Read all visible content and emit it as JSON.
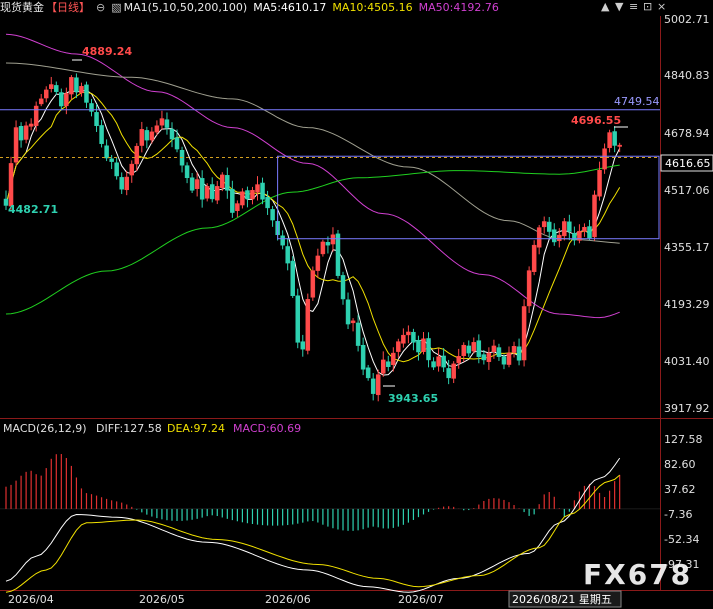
{
  "header": {
    "symbol": "现货黄金",
    "period": "【日线】",
    "ma_label": "MA1(5,10,50,200,100)",
    "ma5": "MA5:4610.17",
    "ma10": "MA10:4505.16",
    "ma50": "MA50:4192.76",
    "controls": [
      "▲",
      "▼",
      "≡",
      "⊡",
      "×"
    ]
  },
  "colors": {
    "up": "#ff4a4a",
    "down": "#2ed1b0",
    "ma5": "#ffffff",
    "ma10": "#f0e000",
    "ma50": "#d040d0",
    "ma100": "#a0a090",
    "ma200": "#20d020",
    "rect": "#7b7bff"
  },
  "price_axis": [
    "5002.71",
    "4840.83",
    "4678.94",
    "4517.06",
    "4355.17",
    "4193.29",
    "4031.40",
    "3917.92"
  ],
  "current_price": "4616.65",
  "annotations": {
    "high": "4889.24",
    "low": "3943.65",
    "start": "4482.71",
    "recent_high": "4696.55",
    "hline": "4749.54"
  },
  "macd_header": {
    "label": "MACD(26,12,9)",
    "diff": "DIFF:127.58",
    "dea": "DEA:97.24",
    "macd": "MACD:60.69"
  },
  "macd_axis": [
    "127.58",
    "82.60",
    "37.62",
    "-7.36",
    "-52.34",
    "-97.31"
  ],
  "x_axis": [
    "2026/04",
    "2026/05",
    "2026/06",
    "2026/07"
  ],
  "cursor_date": "2026/08/21 星期五",
  "watermark": "FX678",
  "chart_data": {
    "type": "candlestick",
    "ylim": [
      3917.92,
      5002.71
    ],
    "hline": 4749.54,
    "current_price": 4616.65,
    "box": {
      "from": 54,
      "to": 110,
      "top": 4620,
      "bottom": 4390
    },
    "closes": [
      4482.71,
      4600,
      4700,
      4665,
      4705,
      4710,
      4760,
      4780,
      4805,
      4820,
      4800,
      4760,
      4795,
      4840,
      4800,
      4815,
      4770,
      4745,
      4705,
      4655,
      4615,
      4605,
      4565,
      4528,
      4562,
      4598,
      4648,
      4695,
      4665,
      4688,
      4705,
      4725,
      4700,
      4668,
      4640,
      4595,
      4560,
      4525,
      4555,
      4500,
      4536,
      4501,
      4536,
      4568,
      4525,
      4463,
      4488,
      4521,
      4501,
      4525,
      4541,
      4500,
      4476,
      4442,
      4401,
      4372,
      4322,
      4231,
      4101,
      4082,
      4221,
      4301,
      4342,
      4381,
      4372,
      4401,
      4287,
      4222,
      4152,
      4161,
      4092,
      4026,
      4002,
      3958,
      4011,
      4052,
      4033,
      4071,
      4103,
      4121,
      4130,
      4101,
      4074,
      4111,
      4052,
      4032,
      4061,
      4032,
      4002,
      4041,
      4062,
      4093,
      4071,
      4101,
      4061,
      4052,
      4071,
      4091,
      4061,
      4040,
      4071,
      4090,
      4051,
      4201,
      4301,
      4372,
      4421,
      4438,
      4410,
      4381,
      4400,
      4438,
      4410,
      4386,
      4411,
      4422,
      4392,
      4512,
      4581,
      4641,
      4686,
      4650,
      4651
    ]
  }
}
